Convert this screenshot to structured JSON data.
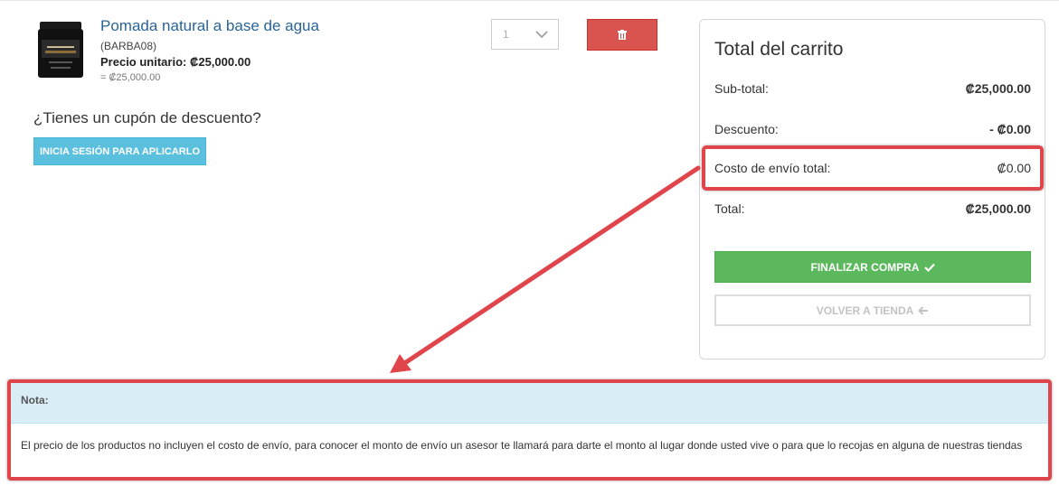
{
  "cart_item": {
    "name": "Pomada natural a base de agua",
    "code": "(BARBA08)",
    "unit_price_label": "Precio unitario: ₡25,000.00",
    "line_total": "= ₡25,000.00",
    "quantity": "1",
    "image_icon": "pomade-jar-image"
  },
  "coupon": {
    "heading": "¿Tienes un cupón de descuento?",
    "button_label": "INICIA SESIÓN PARA APLICARLO"
  },
  "summary": {
    "title": "Total del carrito",
    "rows": [
      {
        "label": "Sub-total:",
        "value": "₡25,000.00"
      },
      {
        "label": "Descuento:",
        "value": "- ₡0.00"
      },
      {
        "label": "Costo de envío total:",
        "value": "₡0.00"
      },
      {
        "label": "Total:",
        "value": "₡25,000.00"
      }
    ],
    "checkout_label": "FINALIZAR COMPRA",
    "back_label": "VOLVER A TIENDA"
  },
  "note": {
    "title": "Nota:",
    "body": "El precio de los productos no incluyen el costo de envío, para conocer el monto de envío un asesor te llamará para darte el monto al lugar donde usted vive o para que lo recojas en alguna de nuestras tiendas"
  },
  "colors": {
    "annotation_red": "#e0454b",
    "delete_red": "#d9534f",
    "info_blue": "#5bc0de",
    "success_green": "#5cb85c",
    "link_blue": "#2a6496",
    "note_header_bg": "#d9edf7"
  }
}
